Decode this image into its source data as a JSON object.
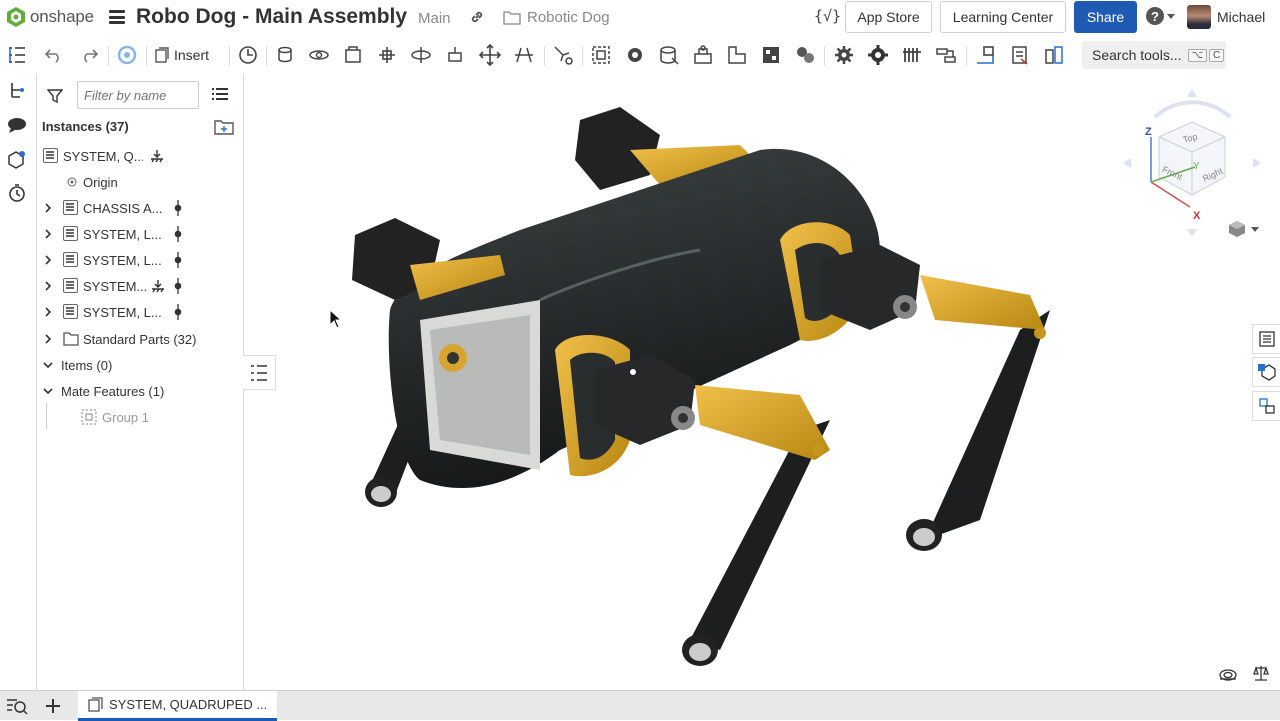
{
  "app": {
    "brand": "onshape",
    "accent": "#1f5bb5",
    "brand_green": "#5fae3b"
  },
  "header": {
    "document_title": "Robo Dog - Main Assembly",
    "branch": "Main",
    "folder": "Robotic Dog",
    "fx_label": "{√}",
    "app_store": "App Store",
    "learning_center": "Learning Center",
    "share": "Share",
    "help_symbol": "?",
    "user_name": "Michael"
  },
  "toolbar": {
    "insert_label": "Insert",
    "search_placeholder": "Search tools...",
    "search_shortcut_1": "⌥",
    "search_shortcut_2": "C",
    "icons": [
      "undo-icon",
      "redo-icon",
      "update-icon",
      "insert-icon",
      "display-states-icon",
      "fastened-mate-icon",
      "revolute-mate-icon",
      "slider-mate-icon",
      "planar-mate-icon",
      "cylindrical-mate-icon",
      "pin-slot-mate-icon",
      "ball-mate-icon",
      "parallel-mate-icon",
      "tangent-mate-icon",
      "mate-connector-icon",
      "replicate-icon",
      "group-icon",
      "relation-icon",
      "gear-relation-icon",
      "rack-pinion-icon",
      "screw-relation-icon",
      "linear-relation-icon",
      "measure-icon",
      "explode-icon",
      "section-view-icon",
      "named-views-icon",
      "appearance-icon",
      "bom-icon"
    ]
  },
  "panel": {
    "filter_placeholder": "Filter by name",
    "instances_title": "Instances (37)",
    "rows": [
      {
        "label": "SYSTEM, Q...",
        "type": "part",
        "indent": 1
      },
      {
        "label": "Origin",
        "type": "origin",
        "indent": 1
      },
      {
        "label": "CHASSIS A...",
        "type": "part",
        "indent": 0
      },
      {
        "label": "SYSTEM, L...",
        "type": "part",
        "indent": 0
      },
      {
        "label": "SYSTEM, L...",
        "type": "part",
        "indent": 0
      },
      {
        "label": "SYSTEM...",
        "type": "part",
        "indent": 0
      },
      {
        "label": "SYSTEM, L...",
        "type": "part",
        "indent": 0
      },
      {
        "label": "Standard Parts (32)",
        "type": "folder",
        "indent": 0
      },
      {
        "label": "Items (0)",
        "type": "section",
        "indent": 0
      },
      {
        "label": "Mate Features (1)",
        "type": "section",
        "indent": 0
      },
      {
        "label": "Group 1",
        "type": "group",
        "indent": 2
      }
    ]
  },
  "viewcube": {
    "top": "Top",
    "front": "Front",
    "right": "Right",
    "axis_z": "Z",
    "axis_y": "Y",
    "axis_x": "X"
  },
  "bottom": {
    "active_tab": "SYSTEM, QUADRUPED ..."
  }
}
